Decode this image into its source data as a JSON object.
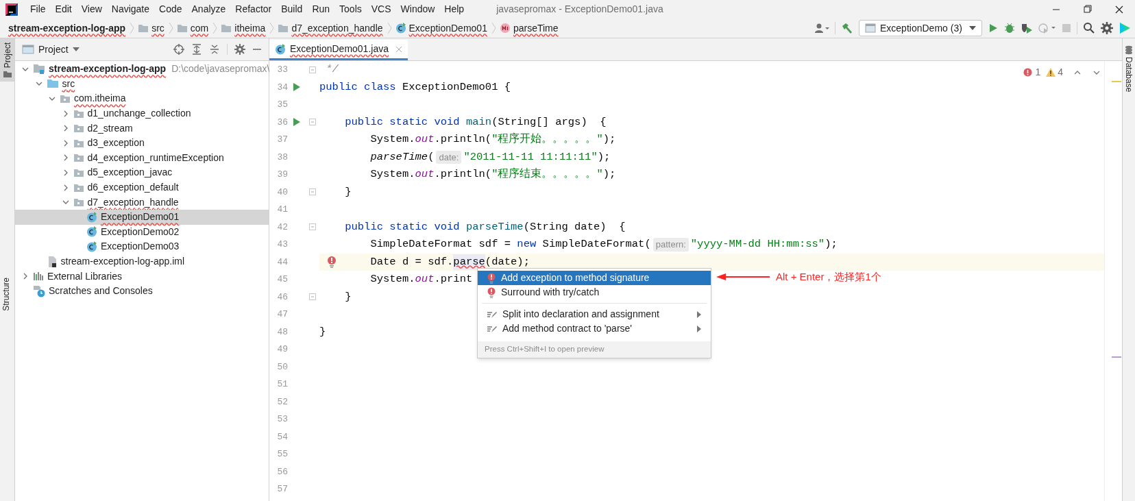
{
  "window": {
    "title": "javasepromax - ExceptionDemo01.java"
  },
  "menu": [
    "File",
    "Edit",
    "View",
    "Navigate",
    "Code",
    "Analyze",
    "Refactor",
    "Build",
    "Run",
    "Tools",
    "VCS",
    "Window",
    "Help"
  ],
  "breadcrumbs": [
    {
      "label": "stream-exception-log-app",
      "kind": "project",
      "squiggle": true
    },
    {
      "label": "src",
      "kind": "folder",
      "squiggle": true
    },
    {
      "label": "com",
      "kind": "folder",
      "squiggle": true
    },
    {
      "label": "itheima",
      "kind": "folder",
      "squiggle": true
    },
    {
      "label": "d7_exception_handle",
      "kind": "folder",
      "squiggle": true
    },
    {
      "label": "ExceptionDemo01",
      "kind": "class",
      "squiggle": true
    },
    {
      "label": "parseTime",
      "kind": "method",
      "squiggle": true
    }
  ],
  "run_config": "ExceptionDemo (3)",
  "side_tabs": {
    "left_top": "Project",
    "left_bottom": "Structure",
    "right": "Database"
  },
  "project_panel": {
    "title": "Project",
    "tree": [
      {
        "label": "stream-exception-log-app",
        "kind": "module",
        "hint": "D:\\code\\javasepromax\\",
        "squiggle": true,
        "selected": false,
        "expanded": true,
        "children": [
          {
            "label": "src",
            "kind": "source",
            "squiggle": true,
            "selected": false,
            "expanded": true,
            "children": [
              {
                "label": "com.itheima",
                "kind": "package",
                "squiggle": true,
                "selected": false,
                "expanded": true,
                "children": [
                  {
                    "label": "d1_unchange_collection",
                    "kind": "package",
                    "squiggle": false,
                    "selected": false,
                    "expanded": false
                  },
                  {
                    "label": "d2_stream",
                    "kind": "package",
                    "squiggle": false,
                    "selected": false,
                    "expanded": false
                  },
                  {
                    "label": "d3_exception",
                    "kind": "package",
                    "squiggle": false,
                    "selected": false,
                    "expanded": false
                  },
                  {
                    "label": "d4_exception_runtimeException",
                    "kind": "package",
                    "squiggle": false,
                    "selected": false,
                    "expanded": false
                  },
                  {
                    "label": "d5_exception_javac",
                    "kind": "package",
                    "squiggle": false,
                    "selected": false,
                    "expanded": false
                  },
                  {
                    "label": "d6_exception_default",
                    "kind": "package",
                    "squiggle": false,
                    "selected": false,
                    "expanded": false
                  },
                  {
                    "label": "d7_exception_handle",
                    "kind": "package",
                    "squiggle": true,
                    "selected": false,
                    "expanded": true,
                    "children": [
                      {
                        "label": "ExceptionDemo01",
                        "kind": "class",
                        "squiggle": true,
                        "selected": true
                      },
                      {
                        "label": "ExceptionDemo02",
                        "kind": "class",
                        "squiggle": false,
                        "selected": false
                      },
                      {
                        "label": "ExceptionDemo03",
                        "kind": "class",
                        "squiggle": false,
                        "selected": false
                      }
                    ]
                  }
                ]
              }
            ]
          },
          {
            "label": "stream-exception-log-app.iml",
            "kind": "file",
            "squiggle": false,
            "selected": false
          }
        ]
      },
      {
        "label": "External Libraries",
        "kind": "libraries",
        "squiggle": false,
        "selected": false,
        "expanded": false
      },
      {
        "label": "Scratches and Consoles",
        "kind": "scratches",
        "squiggle": false,
        "selected": false
      }
    ]
  },
  "editor": {
    "tab": {
      "label": "ExceptionDemo01.java",
      "squiggle": true,
      "selected": true
    },
    "inspections": {
      "errors": "1",
      "warnings": "4"
    },
    "lines": [
      {
        "number": "33",
        "run": false,
        "fold": true,
        "bulb": false,
        "current": false,
        "tokens": [
          {
            "text": " */",
            "kind": "comment"
          }
        ]
      },
      {
        "number": "34",
        "run": true,
        "fold": false,
        "bulb": false,
        "current": false,
        "tokens": [
          {
            "text": "public class ",
            "kind": "kw"
          },
          {
            "text": "ExceptionDemo01 {",
            "kind": "plain"
          }
        ]
      },
      {
        "number": "35",
        "run": false,
        "fold": false,
        "bulb": false,
        "current": false
      },
      {
        "number": "36",
        "run": true,
        "fold": true,
        "bulb": false,
        "current": false,
        "tokens": [
          {
            "text": "    public static void ",
            "kind": "kw"
          },
          {
            "text": "main",
            "kind": "decl"
          },
          {
            "text": "(String[] args)  {",
            "kind": "plain"
          }
        ]
      },
      {
        "number": "37",
        "run": false,
        "fold": false,
        "bulb": false,
        "current": false,
        "tokens": [
          {
            "text": "        System.",
            "kind": "plain"
          },
          {
            "text": "out",
            "kind": "field"
          },
          {
            "text": ".println(",
            "kind": "plain"
          },
          {
            "text": "\"程序开始。。。。。\"",
            "kind": "str"
          },
          {
            "text": ");",
            "kind": "plain"
          }
        ]
      },
      {
        "number": "38",
        "run": false,
        "fold": false,
        "bulb": false,
        "current": false,
        "tokens": [
          {
            "text": "        parseTime",
            "kind": "static"
          },
          {
            "text": "(",
            "kind": "plain"
          },
          {
            "text": "date:",
            "kind": "hint"
          },
          {
            "text": "\"2011-11-11 11:11:11\"",
            "kind": "str"
          },
          {
            "text": ");",
            "kind": "plain"
          }
        ]
      },
      {
        "number": "39",
        "run": false,
        "fold": false,
        "bulb": false,
        "current": false,
        "tokens": [
          {
            "text": "        System.",
            "kind": "plain"
          },
          {
            "text": "out",
            "kind": "field"
          },
          {
            "text": ".println(",
            "kind": "plain"
          },
          {
            "text": "\"程序结束。。。。。\"",
            "kind": "str"
          },
          {
            "text": ");",
            "kind": "plain"
          }
        ]
      },
      {
        "number": "40",
        "run": false,
        "fold": true,
        "bulb": false,
        "current": false,
        "tokens": [
          {
            "text": "    }",
            "kind": "plain"
          }
        ]
      },
      {
        "number": "41",
        "run": false,
        "fold": false,
        "bulb": false,
        "current": false
      },
      {
        "number": "42",
        "run": false,
        "fold": true,
        "bulb": false,
        "current": false,
        "tokens": [
          {
            "text": "    public static void ",
            "kind": "kw"
          },
          {
            "text": "parseTime",
            "kind": "decl"
          },
          {
            "text": "(String date)  {",
            "kind": "plain"
          }
        ]
      },
      {
        "number": "43",
        "run": false,
        "fold": false,
        "bulb": false,
        "current": false,
        "tokens": [
          {
            "text": "        SimpleDateFormat sdf = ",
            "kind": "plain"
          },
          {
            "text": "new ",
            "kind": "kw"
          },
          {
            "text": "SimpleDateFormat(",
            "kind": "plain"
          },
          {
            "text": "pattern:",
            "kind": "hint"
          },
          {
            "text": "\"yyyy-MM-dd HH:mm:ss\"",
            "kind": "str"
          },
          {
            "text": ");",
            "kind": "plain"
          }
        ]
      },
      {
        "number": "44",
        "run": false,
        "fold": false,
        "bulb": true,
        "current": true,
        "tokens": [
          {
            "text": "        Date d = sdf.",
            "kind": "plain"
          },
          {
            "text": "parse",
            "kind": "error"
          },
          {
            "text": "(date);",
            "kind": "plain"
          }
        ]
      },
      {
        "number": "45",
        "run": false,
        "fold": false,
        "bulb": false,
        "current": false,
        "tokens": [
          {
            "text": "        System.",
            "kind": "plain"
          },
          {
            "text": "out",
            "kind": "field"
          },
          {
            "text": ".print",
            "kind": "plain"
          }
        ]
      },
      {
        "number": "46",
        "run": false,
        "fold": true,
        "bulb": false,
        "current": false,
        "tokens": [
          {
            "text": "    }",
            "kind": "plain"
          }
        ]
      },
      {
        "number": "47",
        "run": false,
        "fold": false,
        "bulb": false,
        "current": false
      },
      {
        "number": "48",
        "run": false,
        "fold": false,
        "bulb": false,
        "current": false,
        "tokens": [
          {
            "text": "}",
            "kind": "plain"
          }
        ]
      },
      {
        "number": "49",
        "run": false,
        "fold": false,
        "bulb": false,
        "current": false
      },
      {
        "number": "50",
        "run": false,
        "fold": false,
        "bulb": false,
        "current": false
      },
      {
        "number": "51",
        "run": false,
        "fold": false,
        "bulb": false,
        "current": false
      },
      {
        "number": "52",
        "run": false,
        "fold": false,
        "bulb": false,
        "current": false
      },
      {
        "number": "53",
        "run": false,
        "fold": false,
        "bulb": false,
        "current": false
      },
      {
        "number": "54",
        "run": false,
        "fold": false,
        "bulb": false,
        "current": false
      },
      {
        "number": "55",
        "run": false,
        "fold": false,
        "bulb": false,
        "current": false
      },
      {
        "number": "56",
        "run": false,
        "fold": false,
        "bulb": false,
        "current": false
      },
      {
        "number": "57",
        "run": false,
        "fold": false,
        "bulb": false,
        "current": false
      }
    ]
  },
  "intention_popup": {
    "items": [
      {
        "label": "Add exception to method signature",
        "kind": "error",
        "selected": true,
        "submenu": false
      },
      {
        "label": "Surround with try/catch",
        "kind": "error",
        "selected": false,
        "submenu": false
      },
      {
        "kind": "separator"
      },
      {
        "label": "Split into declaration and assignment",
        "kind": "intention",
        "selected": false,
        "submenu": true
      },
      {
        "label": "Add method contract to 'parse'",
        "kind": "intention",
        "selected": false,
        "submenu": true
      }
    ],
    "footer": "Press Ctrl+Shift+I to open preview"
  },
  "annotation": "Alt + Enter，选择第1个"
}
